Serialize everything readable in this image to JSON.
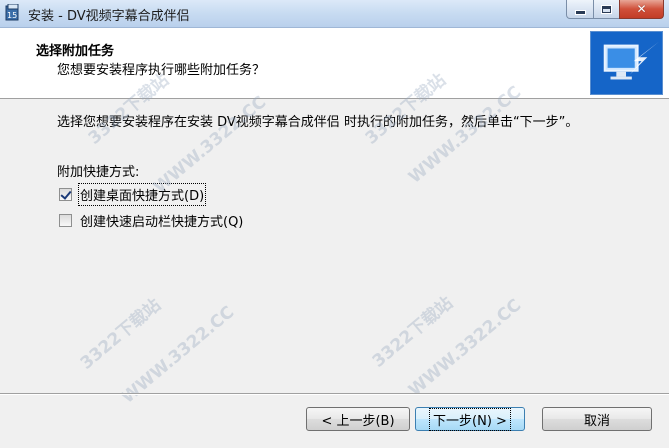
{
  "window": {
    "title": "安装 - DV视频字幕合成伴侣",
    "icon": "installer-app-icon",
    "controls": {
      "minimize": "minimize-icon",
      "maximize": "maximize-icon",
      "close": "close-icon"
    }
  },
  "header": {
    "title": "选择附加任务",
    "subtitle": "您想要安装程序执行哪些附加任务？",
    "image": "setup-wizard-icon"
  },
  "body": {
    "description": "选择您想要安装程序在安装 DV视频字幕合成伴侣 时执行的附加任务，然后单击“下一步”。",
    "group_label": "附加快捷方式:",
    "options": [
      {
        "label": "创建桌面快捷方式(D)",
        "checked": true
      },
      {
        "label": "创建快速启动栏快捷方式(Q)",
        "checked": false
      }
    ]
  },
  "buttons": {
    "back": "< 上一步(B)",
    "next": "下一步(N) >",
    "cancel": "取消"
  },
  "watermark": {
    "text_cn": "3322下载站",
    "text_url": "WWW.3322.CC"
  },
  "colors": {
    "titlebar": "#c9dcf2",
    "header_bg": "#ffffff",
    "dialog_bg": "#f0f0f0",
    "close_button": "#c23c27"
  }
}
